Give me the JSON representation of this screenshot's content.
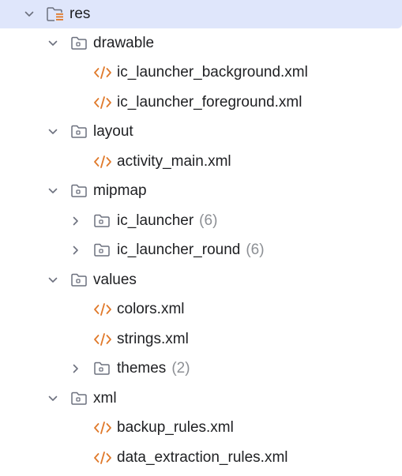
{
  "tree": {
    "root": {
      "label": "res",
      "expanded": true
    },
    "drawable": {
      "label": "drawable",
      "expanded": true
    },
    "ic_launcher_background": {
      "label": "ic_launcher_background.xml"
    },
    "ic_launcher_foreground": {
      "label": "ic_launcher_foreground.xml"
    },
    "layout": {
      "label": "layout",
      "expanded": true
    },
    "activity_main": {
      "label": "activity_main.xml"
    },
    "mipmap": {
      "label": "mipmap",
      "expanded": true
    },
    "ic_launcher": {
      "label": "ic_launcher",
      "count": "(6)",
      "expanded": false
    },
    "ic_launcher_round": {
      "label": "ic_launcher_round",
      "count": "(6)",
      "expanded": false
    },
    "values": {
      "label": "values",
      "expanded": true
    },
    "colors": {
      "label": "colors.xml"
    },
    "strings": {
      "label": "strings.xml"
    },
    "themes": {
      "label": "themes",
      "count": "(2)",
      "expanded": false
    },
    "xml": {
      "label": "xml",
      "expanded": true
    },
    "backup_rules": {
      "label": "backup_rules.xml"
    },
    "data_extraction_rules": {
      "label": "data_extraction_rules.xml"
    }
  },
  "icons": {
    "folder": "folder-icon",
    "res_folder": "resource-folder-icon",
    "xml_file": "xml-file-icon",
    "chevron_down": "chevron-down-icon",
    "chevron_right": "chevron-right-icon"
  },
  "colors": {
    "selection": "#dfe6fb",
    "xml_icon": "#e0792a",
    "folder_icon": "#6c707e",
    "count_text": "#8c8f94"
  }
}
